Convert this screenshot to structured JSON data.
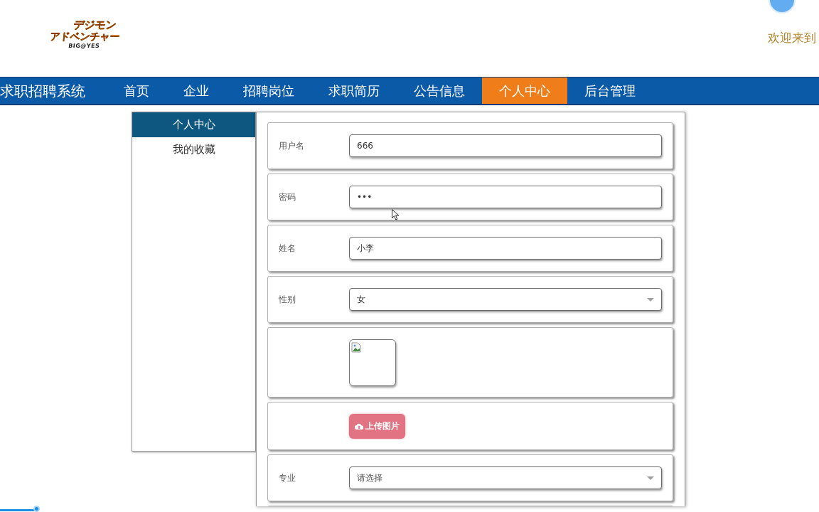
{
  "logo": {
    "lines": [
      "デジモン",
      "アドベンチャー"
    ],
    "tagline": "BIG@YES"
  },
  "header": {
    "welcome": "欢迎来到"
  },
  "nav": {
    "title": "求职招聘系统",
    "items": [
      {
        "label": "首页",
        "selected": false
      },
      {
        "label": "企业",
        "selected": false
      },
      {
        "label": "招聘岗位",
        "selected": false
      },
      {
        "label": "求职简历",
        "selected": false
      },
      {
        "label": "公告信息",
        "selected": false
      },
      {
        "label": "个人中心",
        "selected": true
      },
      {
        "label": "后台管理",
        "selected": false
      }
    ]
  },
  "sidebar": {
    "items": [
      {
        "label": "个人中心",
        "selected": true
      },
      {
        "label": "我的收藏",
        "selected": false
      }
    ]
  },
  "form": {
    "rows": [
      {
        "kind": "input",
        "label": "用户名",
        "value": "666"
      },
      {
        "kind": "input",
        "label": "密码",
        "value": "•••"
      },
      {
        "kind": "input",
        "label": "姓名",
        "value": "小李"
      },
      {
        "kind": "select",
        "label": "性别",
        "value": "女"
      },
      {
        "kind": "image"
      },
      {
        "kind": "upload",
        "button": "上传图片"
      },
      {
        "kind": "select",
        "label": "专业",
        "placeholder": "请选择"
      },
      {
        "kind": "empty"
      }
    ]
  },
  "video_progress": {
    "level": 0.044
  }
}
